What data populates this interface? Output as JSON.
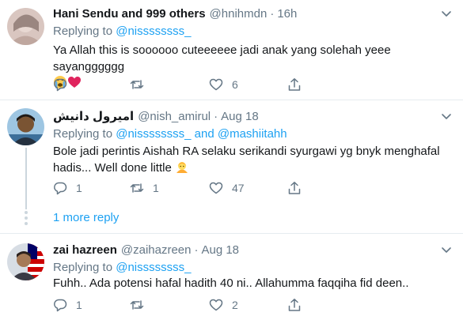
{
  "tweets": [
    {
      "display_name": "Hani Sendu and 999 others",
      "handle": "@hnihmdn",
      "separator": "·",
      "time": "16h",
      "replying_label": "Replying to",
      "replying_to_1": "@nissssssss_",
      "text": "Ya Allah this is soooooo cuteeeeee jadi anak yang solehah yeee sayangggggg",
      "emojis": [
        "crying-face-emoji",
        "heart-emoji"
      ],
      "replies": "",
      "retweets": "",
      "likes": "6"
    },
    {
      "display_name": "امیرول دانیش",
      "handle": "@nish_amirul",
      "separator": "·",
      "time": "Aug 18",
      "replying_label": "Replying to",
      "replying_to_1": "@nissssssss_",
      "replying_and": "and",
      "replying_to_2": "@mashiitahh",
      "text": "Bole jadi perintis Aishah RA selaku serikandi syurgawi yg bnyk menghafal hadis... Well done little",
      "emojis": [
        "person-emoji"
      ],
      "replies": "1",
      "retweets": "1",
      "likes": "47"
    },
    {
      "display_name": "zai hazreen",
      "handle": "@zaihazreen",
      "separator": "·",
      "time": "Aug 18",
      "replying_label": "Replying to",
      "replying_to_1": "@nissssssss_",
      "text": "Fuhh.. Ada potensi hafal hadith 40 ni.. Allahumma faqqiha fid deen..",
      "emojis": [],
      "replies": "1",
      "retweets": "",
      "likes": "2"
    }
  ],
  "more_replies": "1 more reply",
  "colors": {
    "link": "#1da1f2",
    "muted": "#657786",
    "text": "#14171a",
    "divider": "#e6ecf0"
  }
}
